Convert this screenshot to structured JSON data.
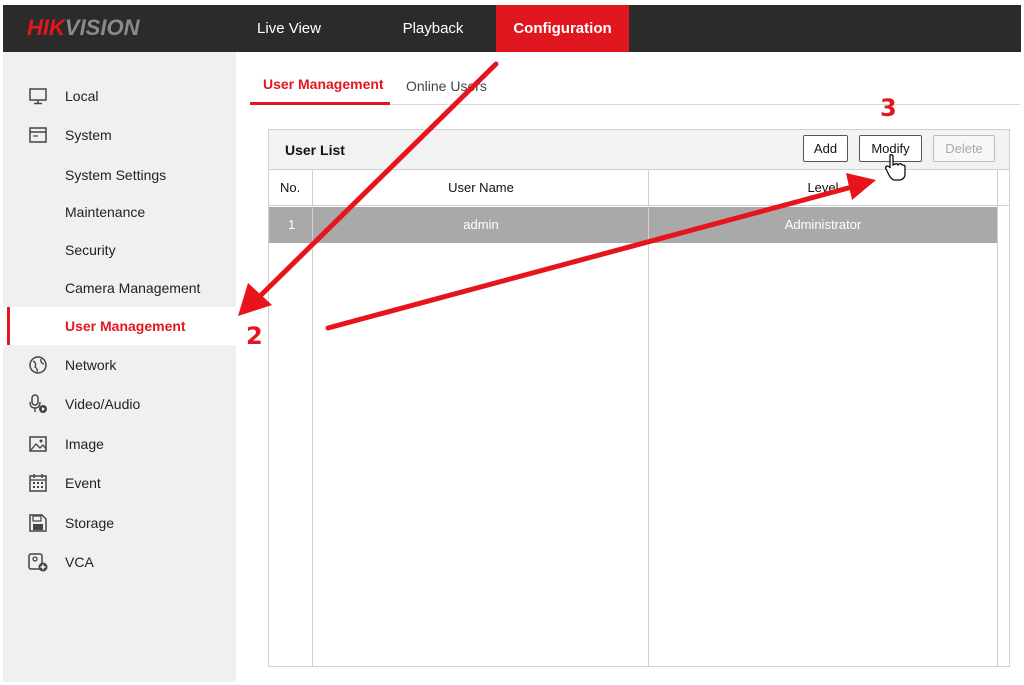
{
  "brand": {
    "red": "HIK",
    "gray": "VISION"
  },
  "nav": {
    "live_view": "Live View",
    "playback": "Playback",
    "configuration": "Configuration"
  },
  "sidebar": {
    "items": [
      {
        "label": "Local",
        "icon": "monitor-icon"
      },
      {
        "label": "System",
        "icon": "system-icon"
      },
      {
        "label": "System Settings"
      },
      {
        "label": "Maintenance"
      },
      {
        "label": "Security"
      },
      {
        "label": "Camera Management"
      },
      {
        "label": "User Management",
        "active": true
      },
      {
        "label": "Network",
        "icon": "globe-icon"
      },
      {
        "label": "Video/Audio",
        "icon": "microphone-icon"
      },
      {
        "label": "Image",
        "icon": "image-icon"
      },
      {
        "label": "Event",
        "icon": "calendar-icon"
      },
      {
        "label": "Storage",
        "icon": "storage-icon"
      },
      {
        "label": "VCA",
        "icon": "vca-icon"
      }
    ]
  },
  "tabs": {
    "user_management": "User Management",
    "online_users": "Online Users"
  },
  "user_list": {
    "title": "User List",
    "add": "Add",
    "modify": "Modify",
    "delete": "Delete",
    "columns": {
      "no": "No.",
      "user_name": "User Name",
      "level": "Level"
    },
    "rows": [
      {
        "no": "1",
        "user_name": "admin",
        "level": "Administrator"
      }
    ]
  },
  "annotations": {
    "step2": "2",
    "step3": "3"
  },
  "colors": {
    "accent": "#e0171f",
    "topbar": "#2b2b2b",
    "sidebar": "#f0f0f0",
    "selected_row": "#a9a9a9"
  }
}
